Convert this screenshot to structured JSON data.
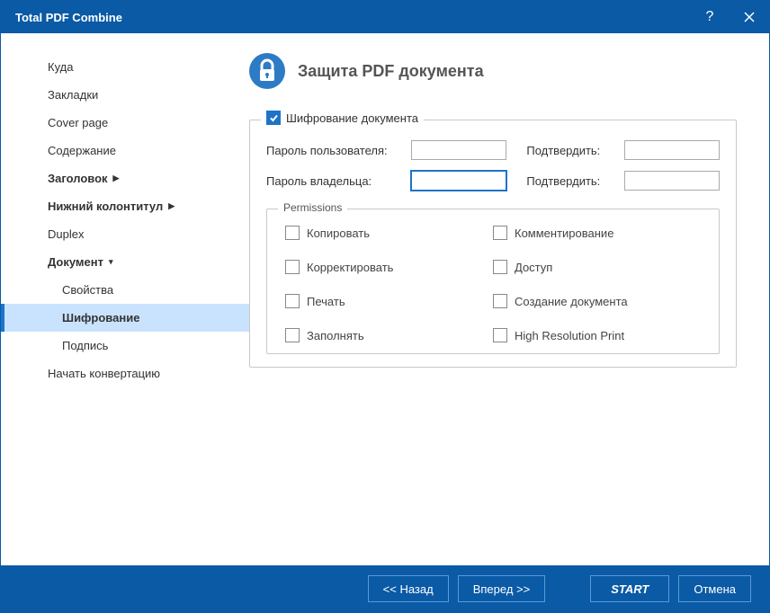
{
  "window": {
    "title": "Total PDF Combine"
  },
  "sidebar": {
    "items": [
      {
        "label": "Куда"
      },
      {
        "label": "Закладки"
      },
      {
        "label": "Cover page"
      },
      {
        "label": "Содержание"
      },
      {
        "label": "Заголовок",
        "bold": true,
        "arrow": true
      },
      {
        "label": "Нижний колонтитул",
        "bold": true,
        "arrow": true
      },
      {
        "label": "Duplex"
      },
      {
        "label": "Документ",
        "bold": true,
        "arrowDown": true
      }
    ],
    "subitems": [
      {
        "label": "Свойства"
      },
      {
        "label": "Шифрование",
        "active": true
      },
      {
        "label": "Подпись"
      }
    ],
    "last": {
      "label": "Начать конвертацию"
    }
  },
  "content": {
    "title": "Защита PDF документа",
    "encrypt_label": "Шифрование документа",
    "user_pw_label": "Пароль пользователя:",
    "owner_pw_label": "Пароль владельца:",
    "confirm_label": "Подтвердить:",
    "permissions_label": "Permissions",
    "permissions": [
      "Копировать",
      "Комментирование",
      "Корректировать",
      "Доступ",
      "Печать",
      "Создание документа",
      "Заполнять",
      "High Resolution Print"
    ]
  },
  "footer": {
    "back": "<<  Назад",
    "forward": "Вперед  >>",
    "start": "START",
    "cancel": "Отмена"
  }
}
